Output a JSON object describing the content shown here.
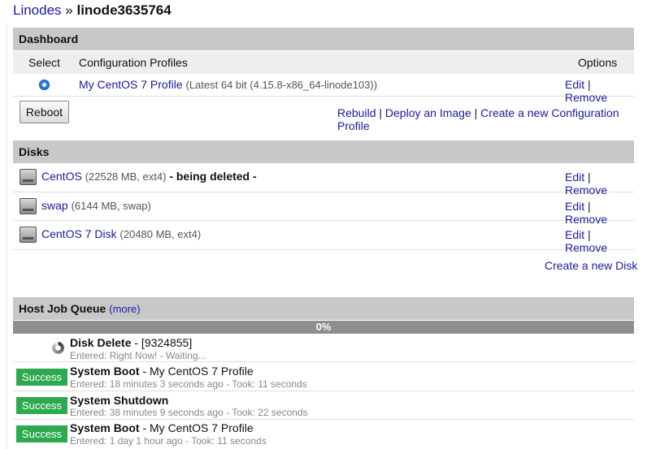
{
  "breadcrumb": {
    "parent": "Linodes",
    "sep": " » ",
    "current": "linode3635764"
  },
  "dashboard": {
    "title": "Dashboard",
    "col_select": "Select",
    "col_profiles": "Configuration Profiles",
    "col_options": "Options",
    "profile": {
      "name": "My CentOS 7 Profile",
      "detail": "(Latest 64 bit (4.15.8-x86_64-linode103))",
      "selected": true
    },
    "edit": "Edit",
    "remove": "Remove",
    "pipe": "|",
    "reboot": "Reboot",
    "rebuild": "Rebuild",
    "deploy": "Deploy an Image",
    "create_profile": "Create a new Configuration Profile"
  },
  "disks": {
    "title": "Disks",
    "items": [
      {
        "name": "CentOS",
        "info": "(22528 MB, ext4)",
        "status": "- being deleted -"
      },
      {
        "name": "swap",
        "info": "(6144 MB, swap)",
        "status": ""
      },
      {
        "name": "CentOS 7 Disk",
        "info": "(20480 MB, ext4)",
        "status": ""
      }
    ],
    "create": "Create a new Disk"
  },
  "jobs": {
    "title": "Host Job Queue",
    "more": "(more)",
    "progress": "0%",
    "items": [
      {
        "badge": "",
        "title": "Disk Delete",
        "sub": " - [9324855]",
        "meta": "Entered: Right Now! - Waiting..."
      },
      {
        "badge": "Success",
        "title": "System Boot",
        "sub": " - My CentOS 7 Profile",
        "meta": "Entered: 18 minutes 3 seconds ago - Took: 11 seconds"
      },
      {
        "badge": "Success",
        "title": "System Shutdown",
        "sub": "",
        "meta": "Entered: 38 minutes 9 seconds ago - Took: 22 seconds"
      },
      {
        "badge": "Success",
        "title": "System Boot",
        "sub": " - My CentOS 7 Profile",
        "meta": "Entered: 1 day 1 hour ago - Took: 11 seconds"
      }
    ]
  },
  "colors": {
    "link": "#1a1aa6",
    "success": "#2da94f",
    "header": "#c8c8c8"
  }
}
